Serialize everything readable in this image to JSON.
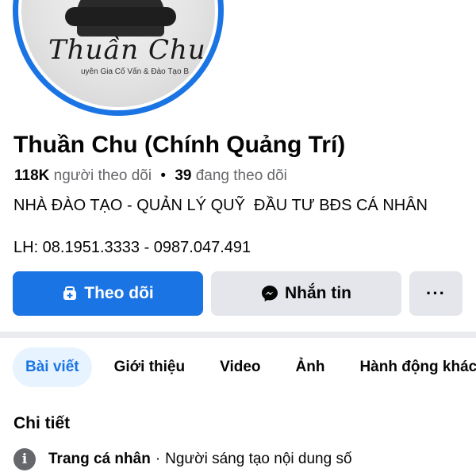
{
  "profile": {
    "avatar_signature": "Thuần Chu",
    "avatar_caption": "uyên Gia Cố Vấn & Đào Tạo B",
    "name": "Thuần Chu (Chính Quảng Trí)",
    "followers_count": "118K",
    "followers_label": "người theo dõi",
    "stats_separator": "•",
    "following_count": "39",
    "following_label": "đang theo dõi",
    "bio": "NHÀ ĐÀO TẠO - QUẢN LÝ QUỸ  ĐẦU TƯ BĐS CÁ NHÂN",
    "contact": "LH: 08.1951.3333 - 0987.047.491"
  },
  "actions": {
    "follow_label": "Theo dõi",
    "message_label": "Nhắn tin",
    "more_label": "···"
  },
  "tabs": [
    {
      "label": "Bài viết",
      "active": true
    },
    {
      "label": "Giới thiệu",
      "active": false
    },
    {
      "label": "Video",
      "active": false
    },
    {
      "label": "Ảnh",
      "active": false
    },
    {
      "label": "Hành động khác",
      "active": false
    }
  ],
  "details": {
    "title": "Chi tiết",
    "info_icon": "i",
    "row_label": "Trang cá nhân",
    "row_separator": "·",
    "row_value": "Người sáng tạo nội dung số"
  },
  "colors": {
    "accent": "#1b74e4",
    "button_secondary": "#e4e6eb",
    "tab_active_bg": "#e7f3ff",
    "muted_text": "#65676b"
  },
  "icons": {
    "follow": "add-friend-icon",
    "message": "messenger-icon",
    "more": "more-icon",
    "info": "info-icon"
  }
}
